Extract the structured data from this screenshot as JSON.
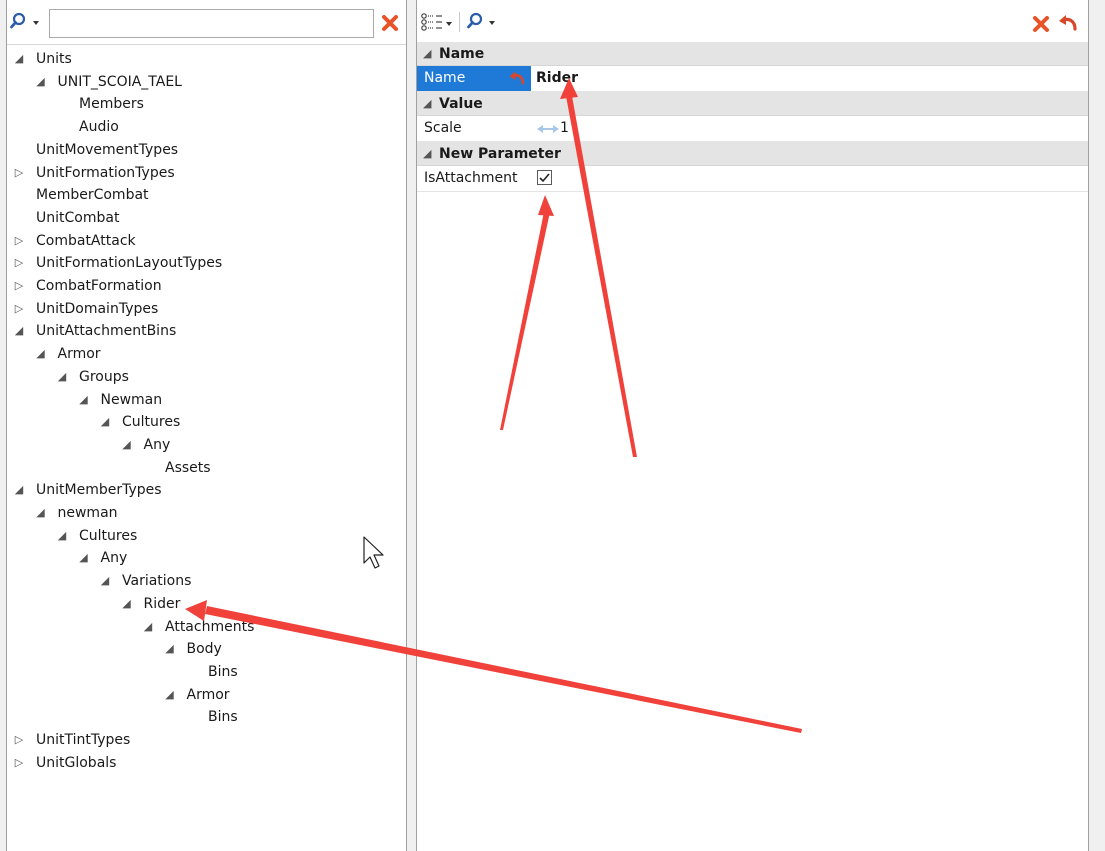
{
  "left_panel": {
    "search": {
      "value": "",
      "placeholder": ""
    },
    "tree": [
      {
        "label": "Units",
        "level": 0,
        "expander": "expanded"
      },
      {
        "label": "UNIT_SCOIA_TAEL",
        "level": 1,
        "expander": "expanded"
      },
      {
        "label": "Members",
        "level": 2,
        "expander": "none"
      },
      {
        "label": "Audio",
        "level": 2,
        "expander": "none"
      },
      {
        "label": "UnitMovementTypes",
        "level": 0,
        "expander": "none"
      },
      {
        "label": "UnitFormationTypes",
        "level": 0,
        "expander": "collapsed"
      },
      {
        "label": "MemberCombat",
        "level": 0,
        "expander": "none"
      },
      {
        "label": "UnitCombat",
        "level": 0,
        "expander": "none"
      },
      {
        "label": "CombatAttack",
        "level": 0,
        "expander": "collapsed"
      },
      {
        "label": "UnitFormationLayoutTypes",
        "level": 0,
        "expander": "collapsed"
      },
      {
        "label": "CombatFormation",
        "level": 0,
        "expander": "collapsed"
      },
      {
        "label": "UnitDomainTypes",
        "level": 0,
        "expander": "collapsed"
      },
      {
        "label": "UnitAttachmentBins",
        "level": 0,
        "expander": "expanded"
      },
      {
        "label": "Armor",
        "level": 1,
        "expander": "expanded"
      },
      {
        "label": "Groups",
        "level": 2,
        "expander": "expanded"
      },
      {
        "label": "Newman",
        "level": 3,
        "expander": "expanded"
      },
      {
        "label": "Cultures",
        "level": 4,
        "expander": "expanded"
      },
      {
        "label": "Any",
        "level": 5,
        "expander": "expanded"
      },
      {
        "label": "Assets",
        "level": 6,
        "expander": "none"
      },
      {
        "label": "UnitMemberTypes",
        "level": 0,
        "expander": "expanded"
      },
      {
        "label": "newman",
        "level": 1,
        "expander": "expanded"
      },
      {
        "label": "Cultures",
        "level": 2,
        "expander": "expanded"
      },
      {
        "label": "Any",
        "level": 3,
        "expander": "expanded"
      },
      {
        "label": "Variations",
        "level": 4,
        "expander": "expanded"
      },
      {
        "label": "Rider",
        "level": 5,
        "expander": "expanded",
        "selected": true
      },
      {
        "label": "Attachments",
        "level": 6,
        "expander": "expanded"
      },
      {
        "label": "Body",
        "level": 7,
        "expander": "expanded"
      },
      {
        "label": "Bins",
        "level": 8,
        "expander": "none"
      },
      {
        "label": "Armor",
        "level": 7,
        "expander": "expanded"
      },
      {
        "label": "Bins",
        "level": 8,
        "expander": "none"
      },
      {
        "label": "UnitTintTypes",
        "level": 0,
        "expander": "collapsed"
      },
      {
        "label": "UnitGlobals",
        "level": 0,
        "expander": "collapsed"
      }
    ]
  },
  "property_grid": {
    "categories": [
      {
        "label": "Name",
        "properties": [
          {
            "name": "Name",
            "value": "Rider",
            "selected": true,
            "has_revert": true,
            "type": "text"
          }
        ]
      },
      {
        "label": "Value",
        "properties": [
          {
            "name": "Scale",
            "value": "1",
            "type": "numeric"
          }
        ]
      },
      {
        "label": "New Parameter",
        "properties": [
          {
            "name": "IsAttachment",
            "value": true,
            "type": "checkbox"
          }
        ]
      }
    ]
  },
  "colors": {
    "selection": "#1e7ad6",
    "annotation_arrow": "#f0413a",
    "clear_icon": "#e8542a",
    "category_bg": "#e4e4e4",
    "search_icon": "#2a5caa"
  },
  "icons": {
    "tree_search": "magnifier-dropdown-icon",
    "tree_clear": "clear-x-icon",
    "grid_view": "categorized-view-dropdown-icon",
    "grid_search": "magnifier-dropdown-icon",
    "grid_clear": "clear-x-icon",
    "grid_revert": "undo-arrow-icon",
    "mouse_cursor": "mouse-pointer-icon"
  }
}
